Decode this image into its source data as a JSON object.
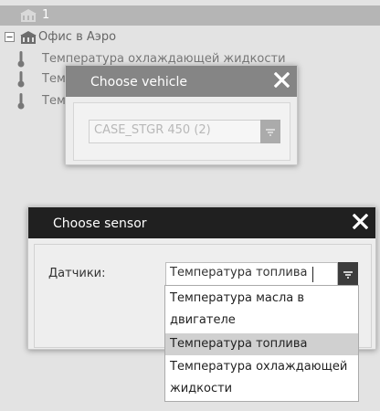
{
  "tree": {
    "selected_row": {
      "label": "1",
      "icon": "building-icon"
    },
    "office_row": {
      "label": "Офис в Аэро",
      "toggle": "collapse-toggle-icon",
      "icon": "building-icon"
    },
    "sensors": [
      {
        "label": "Температура охлаждающей жидкости",
        "icon": "thermometer-icon"
      },
      {
        "label": "Тем",
        "icon": "thermometer-icon"
      },
      {
        "label": "Тем",
        "icon": "thermometer-icon"
      }
    ]
  },
  "vehicle_dialog": {
    "title": "Choose vehicle",
    "selected_value": "CASE_STGR 450 (2)",
    "header_color": "#858585"
  },
  "sensor_dialog": {
    "title": "Choose sensor",
    "field_label": "Датчики:",
    "selected_value": "Температура топлива",
    "header_color": "#202020",
    "options": [
      {
        "line1": "Температура масла в",
        "line2": "двигателе"
      },
      {
        "line1": "Температура топлива",
        "line2": ""
      },
      {
        "line1": "Температура охлаждающей",
        "line2": "жидкости"
      }
    ],
    "highlighted_option": "Температура топлива"
  }
}
